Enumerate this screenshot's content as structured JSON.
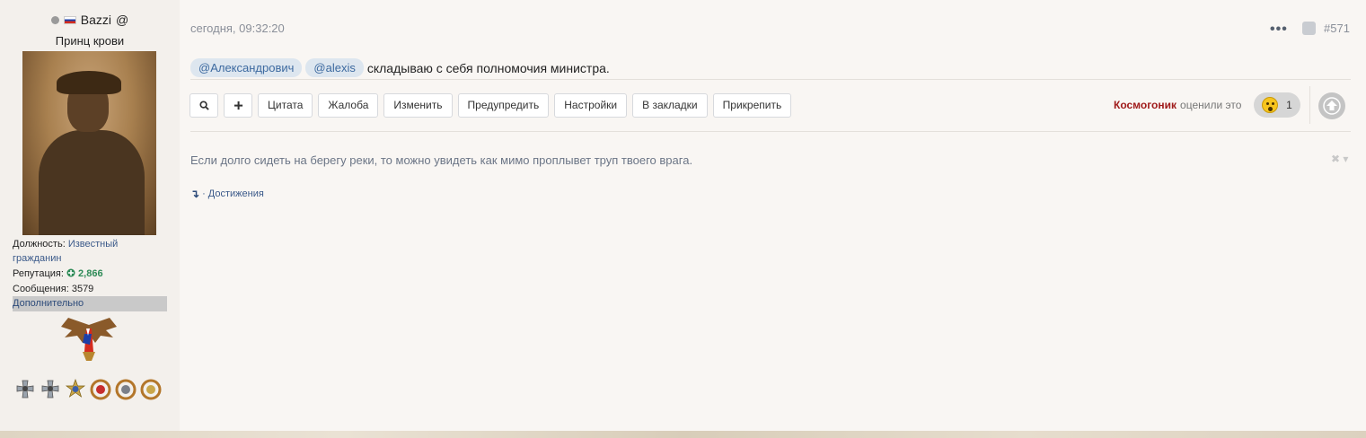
{
  "author": {
    "name": "Bazzi",
    "at_symbol": "@",
    "title": "Принц крови",
    "position_label": "Должность:",
    "position_value_line1": "Известный",
    "position_value_line2": "гражданин",
    "reputation_label": "Репутация:",
    "reputation_value": "2,866",
    "posts_label": "Сообщения:",
    "posts_value": "3579",
    "more_label": "Дополнительно"
  },
  "post": {
    "date": "сегодня, 09:32:20",
    "number": "#571",
    "mentions": [
      "@Александрович",
      "@alexis"
    ],
    "text": "складываю с себя полномочия министра.",
    "signature": "Если долго сидеть на берегу реки, то можно увидеть как мимо проплывет труп твоего врага.",
    "achievements_label": "· Достижения"
  },
  "toolbar": {
    "search_icon": "search-icon",
    "plus_icon": "plus-icon",
    "buttons": [
      "Цитата",
      "Жалоба",
      "Изменить",
      "Предупредить",
      "Настройки",
      "В закладки",
      "Прикрепить"
    ]
  },
  "likes": {
    "user": "Космогоник",
    "suffix": "оценили это",
    "count": "1"
  },
  "colors": {
    "liker": "#a01b1b",
    "reputation": "#2e8b57",
    "mention_bg": "#dde6ef",
    "mention_text": "#3d6aa0"
  }
}
